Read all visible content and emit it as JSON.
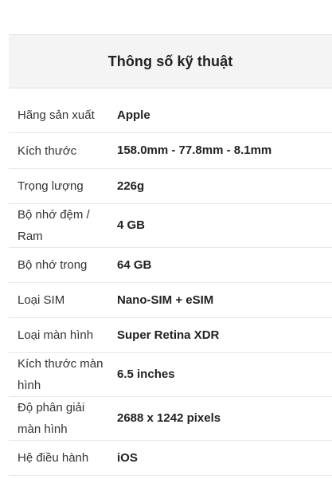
{
  "spec": {
    "title": "Thông số kỹ thuật",
    "rows": [
      {
        "label": "Hãng sản xuất",
        "value": "Apple"
      },
      {
        "label": "Kích thước",
        "value": "158.0mm - 77.8mm - 8.1mm"
      },
      {
        "label": "Trọng lượng",
        "value": "226g"
      },
      {
        "label": "Bộ nhớ đệm / Ram",
        "value": "4 GB"
      },
      {
        "label": "Bộ nhớ trong",
        "value": "64 GB"
      },
      {
        "label": "Loại SIM",
        "value": "Nano-SIM + eSIM"
      },
      {
        "label": "Loại màn hình",
        "value": "Super Retina XDR"
      },
      {
        "label": "Kích thước màn hình",
        "value": "6.5 inches"
      },
      {
        "label": "Độ phân giải màn hình",
        "value": "2688 x 1242 pixels"
      },
      {
        "label": "Hệ điều hành",
        "value": "iOS"
      }
    ]
  }
}
